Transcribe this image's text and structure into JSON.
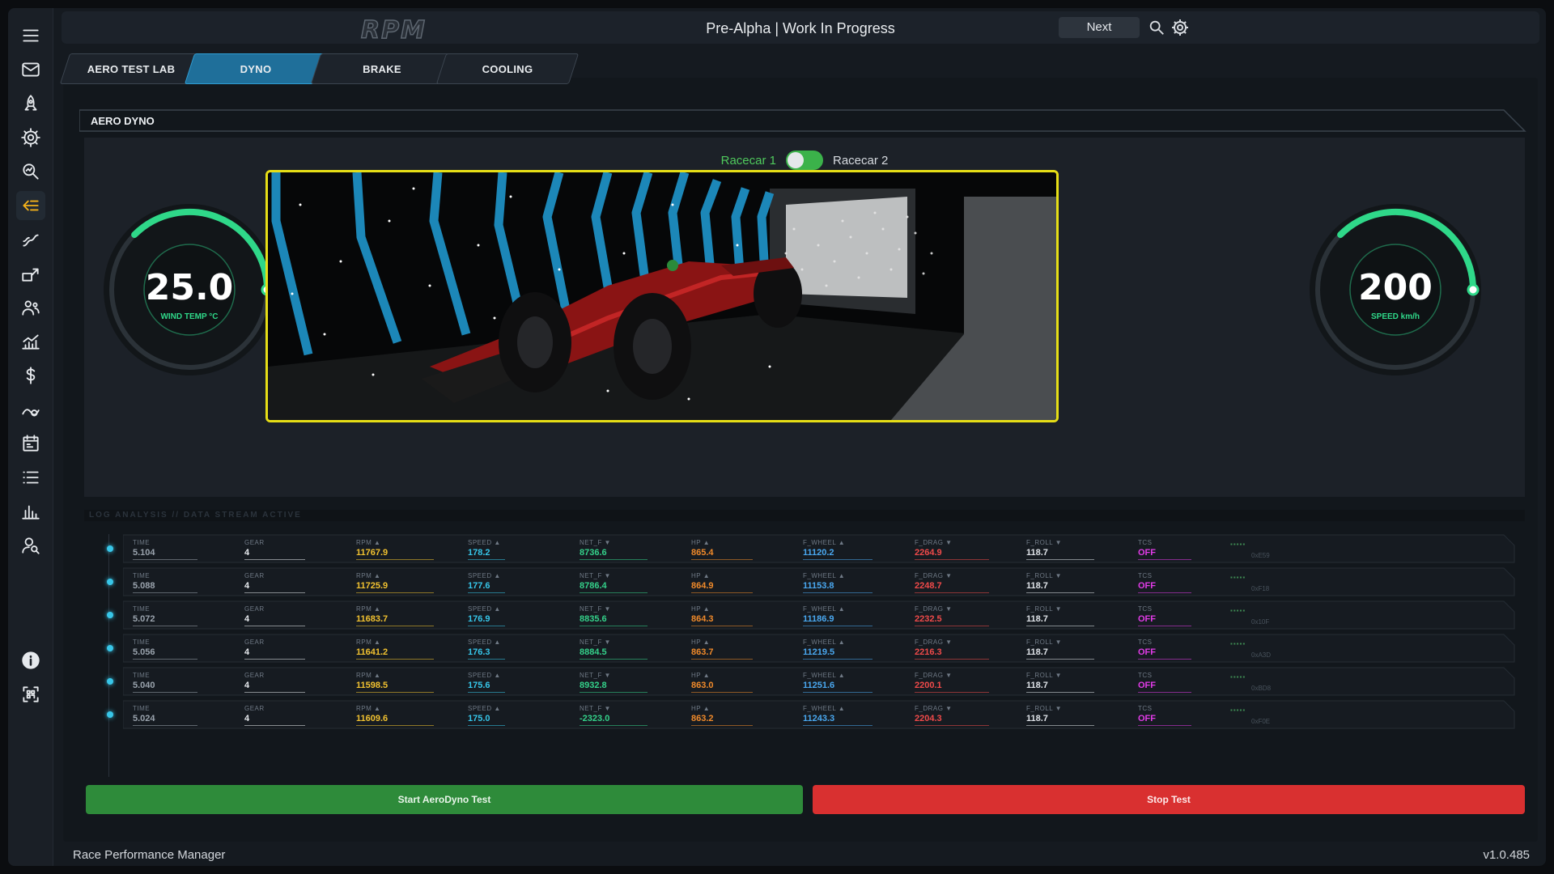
{
  "topbar": {
    "logo": "RPM",
    "title": "Pre-Alpha | Work In Progress",
    "next_label": "Next"
  },
  "sidebar": {
    "items": [
      "menu-icon",
      "mail-icon",
      "rocket-icon",
      "gear-icon",
      "search-analytics-icon",
      "aero-flow-icon",
      "track-curve-icon",
      "upgrade-icon",
      "team-icon",
      "growth-chart-icon",
      "dollar-icon",
      "telemetry-icon",
      "calendar-icon",
      "list-icon",
      "bar-chart-icon",
      "driver-search-icon",
      "info-icon",
      "scan-icon"
    ],
    "active": "aero-flow-icon"
  },
  "tabs": [
    {
      "label": "AERO TEST LAB",
      "active": false
    },
    {
      "label": "DYNO",
      "active": true
    },
    {
      "label": "BRAKE",
      "active": false
    },
    {
      "label": "COOLING",
      "active": false
    }
  ],
  "panel": {
    "title": "AERO DYNO"
  },
  "toggle": {
    "left_label": "Racecar 1",
    "right_label": "Racecar 2",
    "state": "on"
  },
  "gauges": {
    "wind_temp": {
      "value": "25.0",
      "label": "WIND TEMP °C",
      "fill": 0.45
    },
    "speed": {
      "value": "200",
      "label": "SPEED km/h",
      "fill": 0.45
    }
  },
  "colors": {
    "accent": "#2fd889",
    "tab_active": "#1f6f9a",
    "start": "#2e8b3a",
    "stop": "#d93030",
    "viewer_border": "#e6de16"
  },
  "log": {
    "header": "LOG ANALYSIS // DATA STREAM ACTIVE",
    "columns": [
      {
        "key": "time",
        "label": "TIME",
        "color": "#9aa3ad"
      },
      {
        "key": "gear",
        "label": "GEAR",
        "color": "#e6e9ed"
      },
      {
        "key": "rpm",
        "label": "RPM ▲",
        "color": "#f2c230"
      },
      {
        "key": "speed",
        "label": "SPEED ▲",
        "color": "#36c6ea"
      },
      {
        "key": "net_f",
        "label": "NET_F ▼",
        "color": "#34d18a"
      },
      {
        "key": "hp",
        "label": "HP ▲",
        "color": "#f08a2a"
      },
      {
        "key": "f_wheel",
        "label": "F_WHEEL ▲",
        "color": "#4aa8f0"
      },
      {
        "key": "f_drag",
        "label": "F_DRAG ▼",
        "color": "#f04a4a"
      },
      {
        "key": "f_roll",
        "label": "F_ROLL ▼",
        "color": "#dfe3e8"
      },
      {
        "key": "tcs",
        "label": "TCS",
        "color": "#e23be8"
      }
    ],
    "rows": [
      {
        "time": "5.104",
        "gear": "4",
        "rpm": "11767.9",
        "speed": "178.2",
        "net_f": "8736.6",
        "hp": "865.4",
        "f_wheel": "11120.2",
        "f_drag": "2264.9",
        "f_roll": "118.7",
        "tcs": "OFF",
        "hex": "0xE59"
      },
      {
        "time": "5.088",
        "gear": "4",
        "rpm": "11725.9",
        "speed": "177.6",
        "net_f": "8786.4",
        "hp": "864.9",
        "f_wheel": "11153.8",
        "f_drag": "2248.7",
        "f_roll": "118.7",
        "tcs": "OFF",
        "hex": "0xF18"
      },
      {
        "time": "5.072",
        "gear": "4",
        "rpm": "11683.7",
        "speed": "176.9",
        "net_f": "8835.6",
        "hp": "864.3",
        "f_wheel": "11186.9",
        "f_drag": "2232.5",
        "f_roll": "118.7",
        "tcs": "OFF",
        "hex": "0x10F"
      },
      {
        "time": "5.056",
        "gear": "4",
        "rpm": "11641.2",
        "speed": "176.3",
        "net_f": "8884.5",
        "hp": "863.7",
        "f_wheel": "11219.5",
        "f_drag": "2216.3",
        "f_roll": "118.7",
        "tcs": "OFF",
        "hex": "0xA3D"
      },
      {
        "time": "5.040",
        "gear": "4",
        "rpm": "11598.5",
        "speed": "175.6",
        "net_f": "8932.8",
        "hp": "863.0",
        "f_wheel": "11251.6",
        "f_drag": "2200.1",
        "f_roll": "118.7",
        "tcs": "OFF",
        "hex": "0xBD8"
      },
      {
        "time": "5.024",
        "gear": "4",
        "rpm": "11609.6",
        "speed": "175.0",
        "net_f": "-2323.0",
        "hp": "863.2",
        "f_wheel": "11243.3",
        "f_drag": "2204.3",
        "f_roll": "118.7",
        "tcs": "OFF",
        "hex": "0xF0E"
      }
    ]
  },
  "buttons": {
    "start": "Start AeroDyno Test",
    "stop": "Stop Test"
  },
  "footer": {
    "app_name": "Race Performance Manager",
    "version": "v1.0.485"
  }
}
